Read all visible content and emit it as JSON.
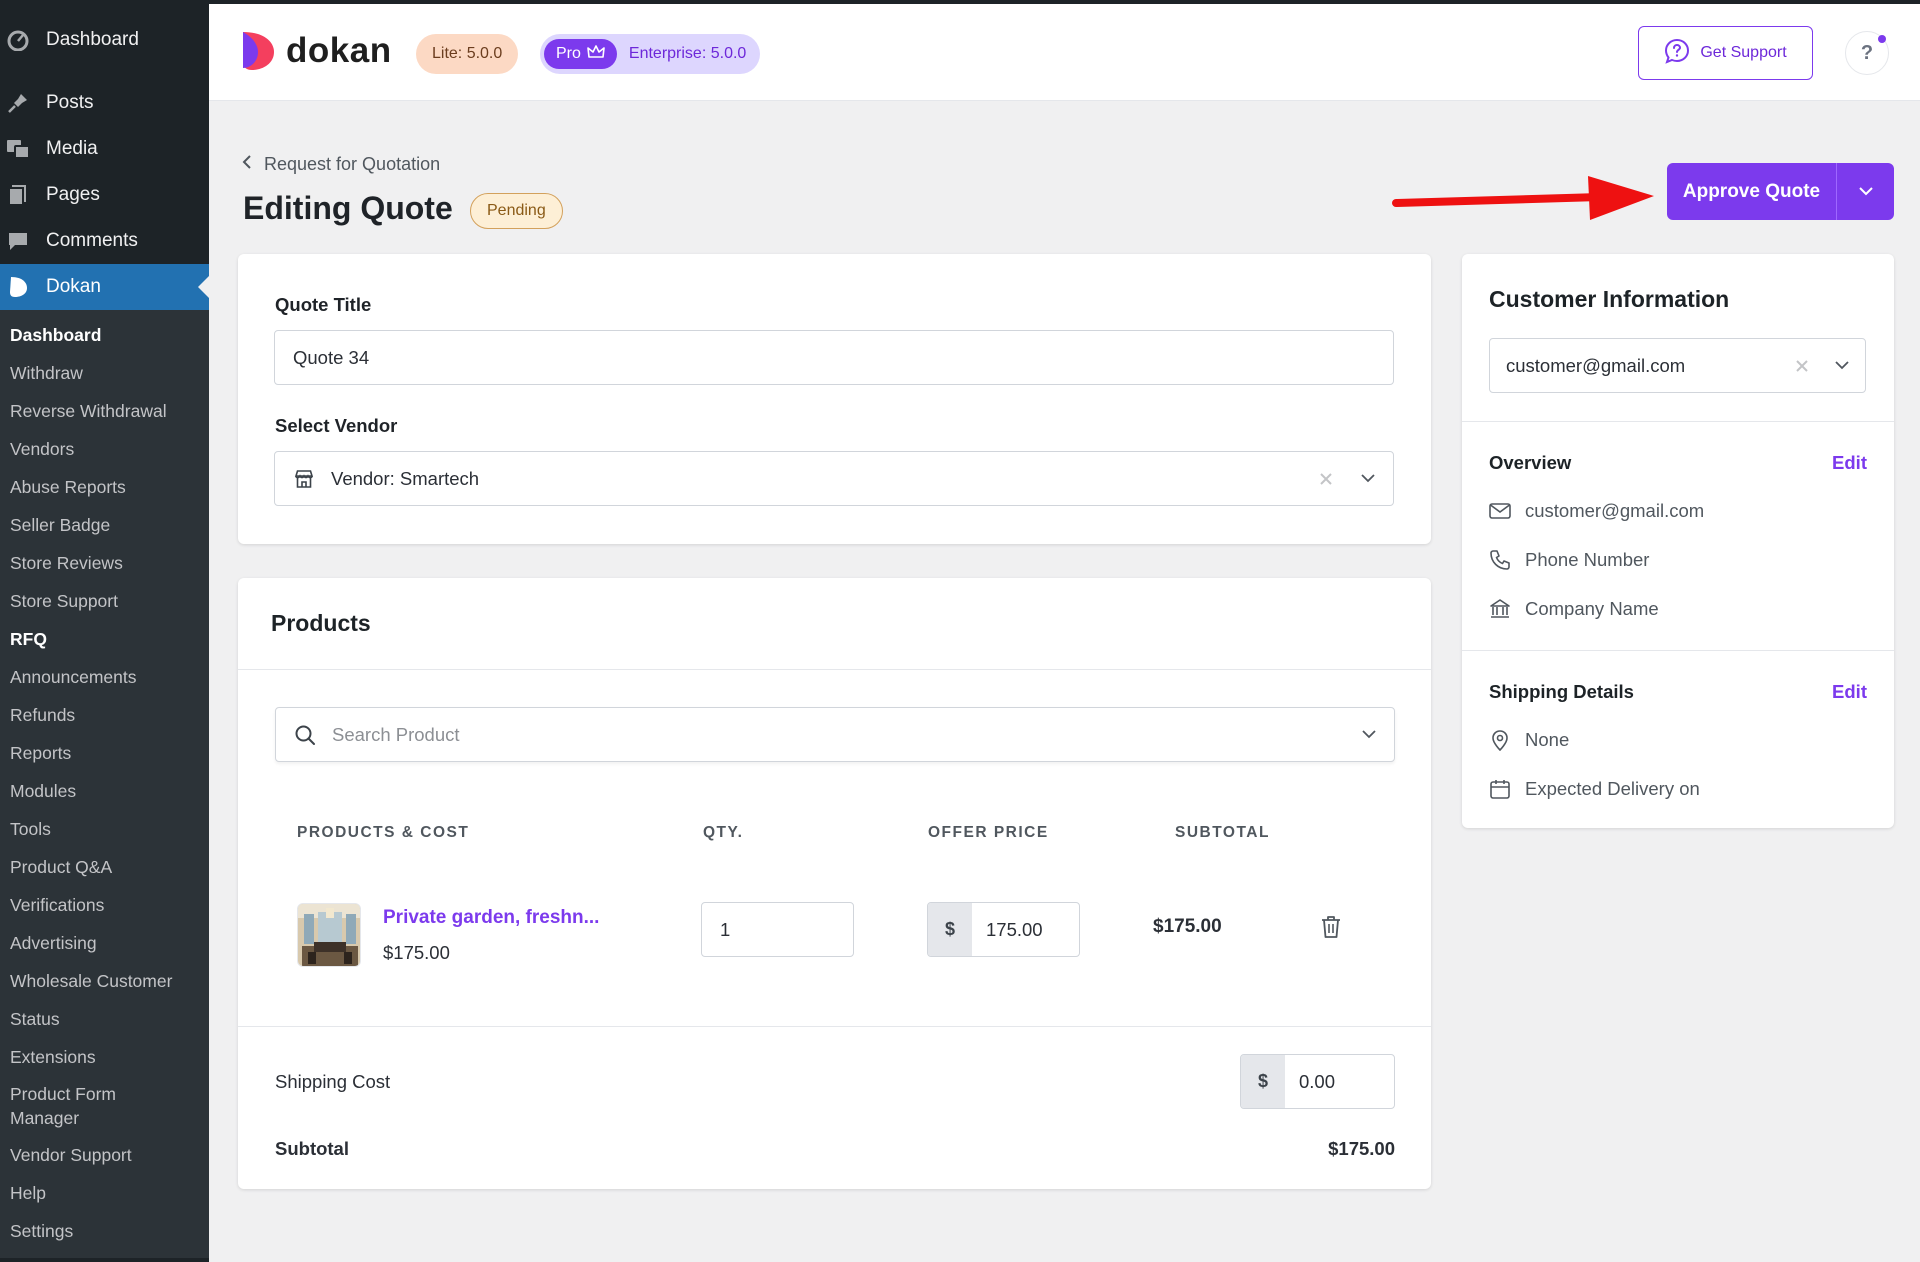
{
  "sidebar": {
    "top_items": [
      {
        "label": "Dashboard",
        "icon": "dashboard-icon"
      },
      {
        "label": "Posts",
        "icon": "pin-icon"
      },
      {
        "label": "Media",
        "icon": "media-icon"
      },
      {
        "label": "Pages",
        "icon": "pages-icon"
      },
      {
        "label": "Comments",
        "icon": "comment-icon"
      },
      {
        "label": "Dokan",
        "icon": "dokan-icon"
      }
    ],
    "submenu": [
      "Dashboard",
      "Withdraw",
      "Reverse Withdrawal",
      "Vendors",
      "Abuse Reports",
      "Seller Badge",
      "Store Reviews",
      "Store Support",
      "RFQ",
      "Announcements",
      "Refunds",
      "Reports",
      "Modules",
      "Tools",
      "Product Q&A",
      "Verifications",
      "Advertising",
      "Wholesale Customer",
      "Status",
      "Extensions",
      "Product Form Manager",
      "Vendor Support",
      "Help",
      "Settings"
    ]
  },
  "header": {
    "logo_text": "dokan",
    "lite_badge": "Lite: 5.0.0",
    "pro_badge": "Pro",
    "enterprise_badge": "Enterprise: 5.0.0",
    "support_label": "Get Support",
    "help_label": "?"
  },
  "page": {
    "breadcrumb": "Request for Quotation",
    "title": "Editing Quote",
    "status": "Pending",
    "approve_label": "Approve Quote"
  },
  "quote": {
    "title_label": "Quote Title",
    "title_value": "Quote 34",
    "vendor_label": "Select Vendor",
    "vendor_value": "Vendor: Smartech"
  },
  "products": {
    "heading": "Products",
    "search_placeholder": "Search Product",
    "columns": [
      "PRODUCTS & COST",
      "QTY.",
      "OFFER PRICE",
      "SUBTOTAL"
    ],
    "rows": [
      {
        "name": "Private garden, freshn...",
        "price": "$175.00",
        "qty": "1",
        "currency": "$",
        "offer_price": "175.00",
        "subtotal": "$175.00"
      }
    ],
    "shipping_label": "Shipping Cost",
    "shipping_currency": "$",
    "shipping_value": "0.00",
    "subtotal_label": "Subtotal",
    "subtotal_value": "$175.00"
  },
  "customer": {
    "heading": "Customer Information",
    "selected": "customer@gmail.com",
    "overview_label": "Overview",
    "edit_label": "Edit",
    "email": "customer@gmail.com",
    "phone": "Phone Number",
    "company": "Company Name",
    "shipping_label": "Shipping Details",
    "address": "None",
    "delivery": "Expected Delivery on"
  },
  "colors": {
    "accent": "#7c3aed",
    "admin_bar": "#1d2327",
    "active_menu": "#2271b1",
    "arrow": "#ee1111"
  }
}
